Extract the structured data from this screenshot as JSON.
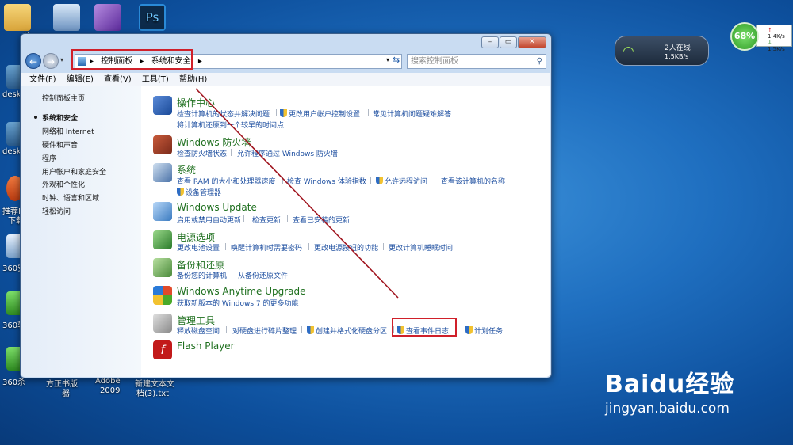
{
  "desktop": {
    "left_labels": [
      "D",
      "desk",
      "desk",
      "推荐F",
      "下载",
      "360安",
      "360软",
      "360杀"
    ],
    "bottom_labels": [
      "方正书版",
      "器",
      "Adobe",
      "2009",
      "新建文本文",
      "档(3).txt"
    ]
  },
  "window": {
    "address": [
      "控制面板",
      "系统和安全"
    ],
    "search_placeholder": "搜索控制面板",
    "menu": [
      "文件(F)",
      "编辑(E)",
      "查看(V)",
      "工具(T)",
      "帮助(H)"
    ],
    "sidebar": {
      "home": "控制面板主页",
      "items": [
        "系统和安全",
        "网络和 Internet",
        "硬件和声音",
        "程序",
        "用户帐户和家庭安全",
        "外观和个性化",
        "时钟、语言和区域",
        "轻松访问"
      ]
    },
    "categories": [
      {
        "title": "操作中心",
        "links": [
          "检查计算机的状态并解决问题",
          "更改用户帐户控制设置",
          "常见计算机问题疑难解答",
          "将计算机还原到一个较早的时间点"
        ]
      },
      {
        "title": "Windows 防火墙",
        "links": [
          "检查防火墙状态",
          "允许程序通过 Windows 防火墙"
        ]
      },
      {
        "title": "系统",
        "links": [
          "查看 RAM 的大小和处理器速度",
          "检查 Windows 体验指数",
          "允许远程访问",
          "查看该计算机的名称",
          "设备管理器"
        ]
      },
      {
        "title": "Windows Update",
        "links": [
          "启用或禁用自动更新",
          "检查更新",
          "查看已安装的更新"
        ]
      },
      {
        "title": "电源选项",
        "links": [
          "更改电池设置",
          "唤醒计算机时需要密码",
          "更改电源按钮的功能",
          "更改计算机睡眠时间"
        ]
      },
      {
        "title": "备份和还原",
        "links": [
          "备份您的计算机",
          "从备份还原文件"
        ]
      },
      {
        "title": "Windows Anytime Upgrade",
        "links": [
          "获取新版本的 Windows 7 的更多功能"
        ]
      },
      {
        "title": "管理工具",
        "links": [
          "释放磁盘空间",
          "对硬盘进行碎片整理",
          "创建并格式化硬盘分区",
          "查看事件日志",
          "计划任务"
        ]
      },
      {
        "title": "Flash Player",
        "links": []
      }
    ]
  },
  "network": {
    "online": "2人在线",
    "speed": "1.5KB/s"
  },
  "speedmeter": {
    "percent": "68%",
    "up": "1.4K/s",
    "down": "1.5K/s"
  },
  "watermark": {
    "brand": "Baidu经验",
    "url": "jingyan.baidu.com"
  },
  "colors": {
    "annotation": "#d0202a"
  }
}
